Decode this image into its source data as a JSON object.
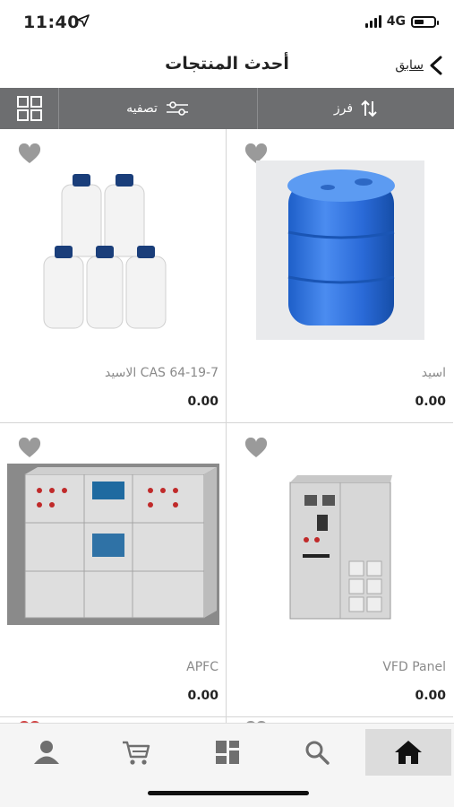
{
  "status_bar": {
    "time": "11:40",
    "network": "4G"
  },
  "header": {
    "title": "أحدث المنتجات",
    "back_label": "سابق"
  },
  "toolbar": {
    "filter_label": "تصفيه",
    "sort_label": "فرز"
  },
  "products": [
    {
      "name": "الاسيد CAS 64-19-7",
      "price": "0.00"
    },
    {
      "name": "اسيد",
      "price": "0.00"
    },
    {
      "name": "APFC",
      "price": "0.00"
    },
    {
      "name": "VFD Panel",
      "price": "0.00"
    }
  ],
  "colors": {
    "toolbar": "#6d6e70",
    "heart": "#9a9a9a",
    "nav_active": "#dcdcdc",
    "icon": "#6f6f6f"
  },
  "icons": {
    "header": "chevron-left-icon",
    "toolbar": [
      "grid-view-icon",
      "filter-sliders-icon",
      "sort-arrows-icon"
    ],
    "nav": [
      "user-icon",
      "cart-icon",
      "categories-icon",
      "search-icon",
      "home-icon"
    ]
  }
}
